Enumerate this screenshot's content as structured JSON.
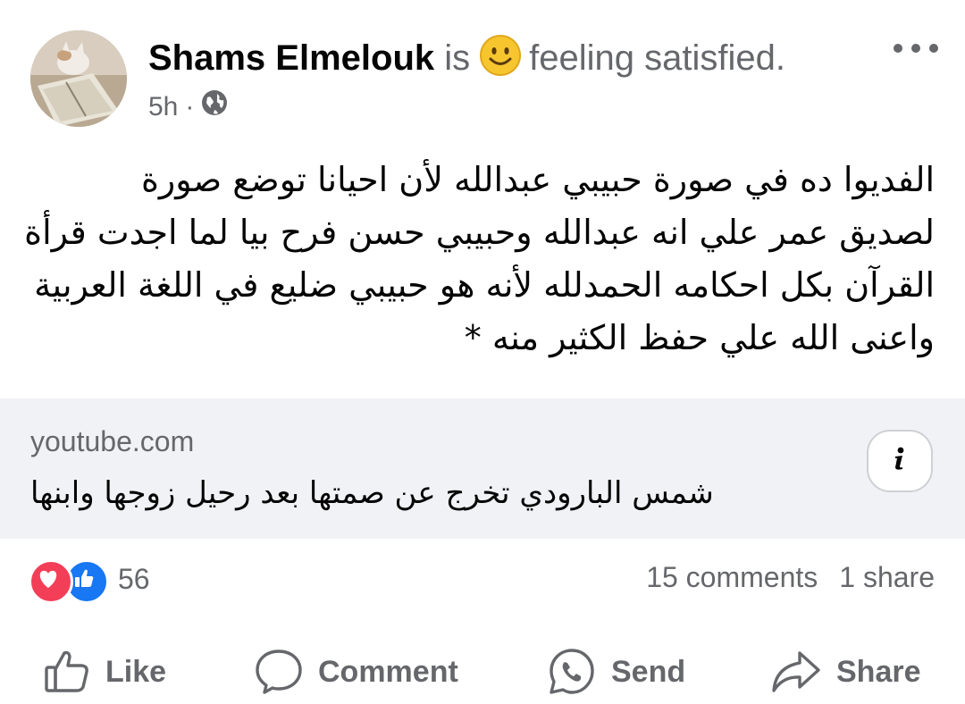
{
  "post": {
    "author": "Shams Elmelouk",
    "is_word": "is",
    "feeling": "feeling satisfied.",
    "emoji_icon": "slightly-smiling-face-icon",
    "time": "5h",
    "dot": "·",
    "audience_icon": "globe-icon",
    "text_lines": [
      "الفديوا ده في صورة حبيبي عبدالله لأن احيانا توضع صورة",
      "لصديق عمر علي انه عبدالله وحبيبي حسن فرح بيا لما اجدت قرأة",
      "القرآن بكل احكامه الحمدلله لأنه هو حبيبي ضليع في اللغة العربية",
      "واعنى الله علي حفظ الكثير منه  *"
    ]
  },
  "link": {
    "domain": "youtube.com",
    "title": "شمس البارودي تخرج عن صمتها بعد رحيل زوجها وابنها",
    "info_icon": "info-icon"
  },
  "stats": {
    "reaction_count": "56",
    "comments": "15 comments",
    "shares": "1 share"
  },
  "actions": {
    "like": "Like",
    "comment": "Comment",
    "send": "Send",
    "share": "Share"
  },
  "colors": {
    "text": "#050505",
    "secondary": "#65676b",
    "card_bg": "#f0f2f5",
    "love": "#f33e58",
    "like": "#1877f2",
    "emoji": "#f7c62f"
  }
}
